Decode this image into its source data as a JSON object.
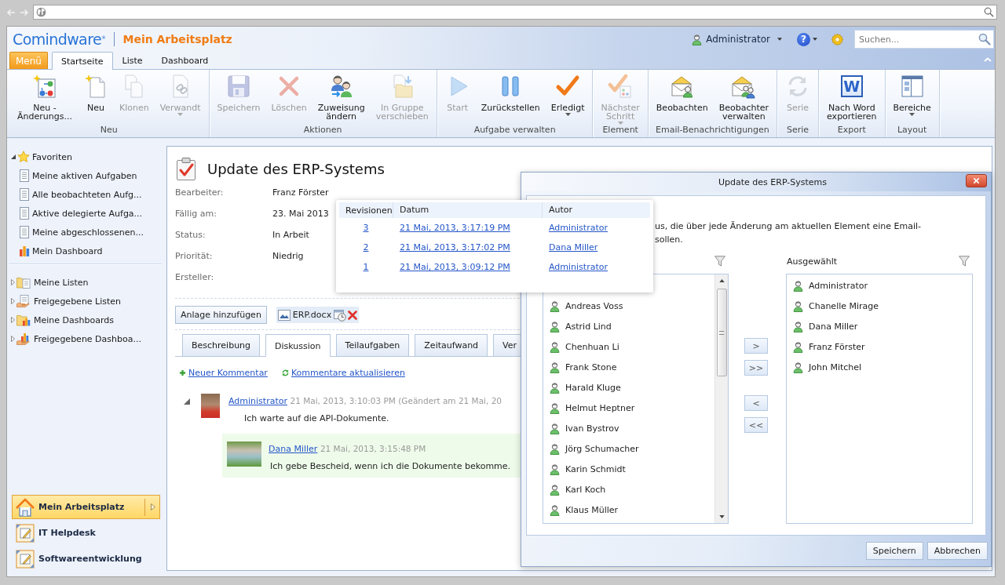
{
  "header": {
    "logo": "Comindware$^{®}$",
    "title": "Mein Arbeitsplatz",
    "user": "Administrator",
    "help": "?",
    "search": {
      "placeholder": "Suchen..."
    }
  },
  "menu_button": "Menü",
  "tabs": [
    {
      "label": "Startseite",
      "selected": true
    },
    {
      "label": "Liste",
      "selected": false
    },
    {
      "label": "Dashboard",
      "selected": false
    }
  ],
  "ribbon": {
    "groups": [
      {
        "label": "Neu",
        "buttons": [
          {
            "kind": "wizard",
            "label": "Neu -\nÄnderungs...",
            "disabled": false,
            "dropdown": false
          },
          {
            "kind": "new",
            "label": "Neu",
            "disabled": false,
            "dropdown": false
          },
          {
            "kind": "clone",
            "label": "Klonen",
            "disabled": true,
            "dropdown": false
          },
          {
            "kind": "link",
            "label": "Verwandt",
            "disabled": true,
            "dropdown": true
          }
        ]
      },
      {
        "label": "Aktionen",
        "buttons": [
          {
            "kind": "save",
            "label": "Speichern",
            "disabled": true,
            "dropdown": false
          },
          {
            "kind": "delete",
            "label": "Löschen",
            "disabled": true,
            "dropdown": false
          },
          {
            "kind": "assign",
            "label": "Zuweisung\nändern",
            "disabled": false,
            "dropdown": false
          },
          {
            "kind": "move",
            "label": "In Gruppe\nverschieben",
            "disabled": true,
            "dropdown": false
          }
        ]
      },
      {
        "label": "Aufgabe verwalten",
        "buttons": [
          {
            "kind": "play",
            "label": "Start",
            "disabled": true,
            "dropdown": false
          },
          {
            "kind": "pause",
            "label": "Zurückstellen",
            "disabled": false,
            "dropdown": false
          },
          {
            "kind": "check",
            "label": "Erledigt",
            "disabled": false,
            "dropdown": true
          }
        ]
      },
      {
        "label": "Element",
        "buttons": [
          {
            "kind": "step",
            "label": "Nächster\nSchritt",
            "disabled": true,
            "dropdown": true
          }
        ]
      },
      {
        "label": "Email-Benachrichtigungen",
        "buttons": [
          {
            "kind": "mail",
            "label": "Beobachten",
            "disabled": false,
            "dropdown": false
          },
          {
            "kind": "mailgroup",
            "label": "Beobachter\nverwalten",
            "disabled": false,
            "dropdown": false
          }
        ]
      },
      {
        "label": "Serie",
        "buttons": [
          {
            "kind": "refresh",
            "label": "Serie",
            "disabled": true,
            "dropdown": false
          }
        ]
      },
      {
        "label": "Export",
        "buttons": [
          {
            "kind": "word",
            "label": "Nach Word\nexportieren",
            "icon_letter": "W",
            "disabled": false,
            "dropdown": false
          }
        ]
      },
      {
        "label": "Layout",
        "buttons": [
          {
            "kind": "panes",
            "label": "Bereiche",
            "disabled": false,
            "dropdown": true
          }
        ]
      }
    ]
  },
  "sidebar": {
    "favorites": [
      {
        "label": "Favoriten",
        "kind": "star",
        "expanded": true,
        "children": [
          {
            "label": "Meine aktiven Aufgaben",
            "kind": "list"
          },
          {
            "label": "Alle beobachteten Aufg...",
            "kind": "list"
          },
          {
            "label": "Aktive delegierte Aufga...",
            "kind": "list"
          },
          {
            "label": "Meine abgeschlossenen...",
            "kind": "list"
          },
          {
            "label": "Mein Dashboard",
            "kind": "dashboard"
          }
        ]
      }
    ],
    "lists": [
      {
        "label": "Meine Listen",
        "kind": "folderlist",
        "expanded": false
      },
      {
        "label": "Freigegebene Listen",
        "kind": "sharedlist",
        "expanded": false
      },
      {
        "label": "Meine Dashboards",
        "kind": "folderdashboard",
        "expanded": false
      },
      {
        "label": "Freigegebene Dashboa...",
        "kind": "shareddashboard",
        "expanded": false
      }
    ],
    "workspaces": [
      {
        "label": "Mein Arbeitsplatz",
        "kind": "home",
        "selected": true
      },
      {
        "label": "IT Helpdesk",
        "kind": "workspace",
        "selected": false
      },
      {
        "label": "Softwareentwicklung",
        "kind": "workspace",
        "selected": false
      }
    ]
  },
  "task": {
    "title": "Update des ERP-Systems",
    "fields": [
      {
        "label": "Bearbeiter:",
        "value": "Franz Förster"
      },
      {
        "label": "Fällig am:",
        "value": "23. Mai 2013"
      },
      {
        "label": "Status:",
        "value": "In Arbeit"
      },
      {
        "label": "Priorität:",
        "value": "Niedrig"
      },
      {
        "label": "Ersteller:"
      }
    ],
    "attach_button": "Anlage hinzufügen",
    "attachments": [
      {
        "name": "ERP.docx"
      }
    ],
    "tabs": [
      {
        "label": "Beschreibung",
        "selected": false
      },
      {
        "label": "Diskussion",
        "selected": true
      },
      {
        "label": "Teilaufgaben",
        "selected": false
      },
      {
        "label": "Zeitaufwand",
        "selected": false
      },
      {
        "label": "Ver",
        "selected": false
      }
    ],
    "actions": [
      {
        "kind": "add",
        "label": "Neuer Kommentar"
      },
      {
        "kind": "refresh",
        "label": "Kommentare aktualisieren"
      }
    ],
    "comments": [
      {
        "author": "Administrator",
        "meta": "21 Mai, 2013, 3:10:03 PM (Geändert am 21 Mai, 20",
        "text": "Ich warte auf die API-Dokumente.",
        "expanded": true,
        "children": [
          {
            "author": "Dana Miller",
            "meta": "21 Mai, 2013, 3:15:48 PM",
            "text": "Ich gebe Bescheid, wenn ich die Dokumente bekomme."
          }
        ]
      }
    ]
  },
  "revisions": {
    "columns": [
      "Revisionen",
      "Datum",
      "Autor"
    ],
    "rows": [
      {
        "revision": "3",
        "date": "21 Mai, 2013, 3:17:19 PM",
        "author": "Administrator"
      },
      {
        "revision": "2",
        "date": "21 Mai, 2013, 3:17:02 PM",
        "author": "Dana Miller"
      },
      {
        "revision": "1",
        "date": "21 Mai, 2013, 3:09:12 PM",
        "author": "Administrator"
      }
    ]
  },
  "dialog": {
    "title": "Update des ERP-Systems",
    "description_fragments": [
      "us, die über jede Änderung am aktuellen Element eine Email-",
      "sollen."
    ],
    "available": [
      "Andreas Voss",
      "Astrid Lind",
      "Chenhuan Li",
      "Frank Stone",
      "Harald Kluge",
      "Helmut Heptner",
      "Ivan Bystrov",
      "Jörg Schumacher",
      "Karin Schmidt",
      "Karl Koch",
      "Klaus Müller"
    ],
    "selected_heading": "Ausgewählt",
    "selected": [
      "Administrator",
      "Chanelle Mirage",
      "Dana Miller",
      "Franz Förster",
      "John Mitchel"
    ],
    "move_buttons": [
      ">",
      ">>",
      "<",
      "<<"
    ],
    "buttons": [
      "Speichern",
      "Abbrechen"
    ]
  }
}
